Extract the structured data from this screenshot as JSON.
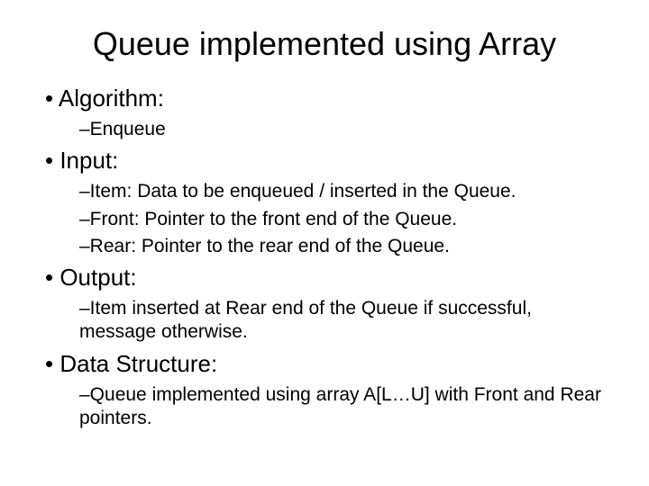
{
  "title": "Queue implemented using Array",
  "sections": {
    "algorithm": {
      "heading": "• Algorithm:",
      "items": [
        "–Enqueue"
      ]
    },
    "input": {
      "heading": "• Input:",
      "items": [
        "–Item: Data to be enqueued / inserted in the Queue.",
        "–Front: Pointer to the front end of the Queue.",
        "–Rear: Pointer to the rear end of the Queue."
      ]
    },
    "output": {
      "heading": "• Output:",
      "items": [
        "–Item inserted at Rear end of the Queue if successful, message otherwise."
      ]
    },
    "datastructure": {
      "heading": "• Data Structure:",
      "items": [
        "–Queue implemented using array A[L…U] with Front and Rear pointers."
      ]
    }
  }
}
